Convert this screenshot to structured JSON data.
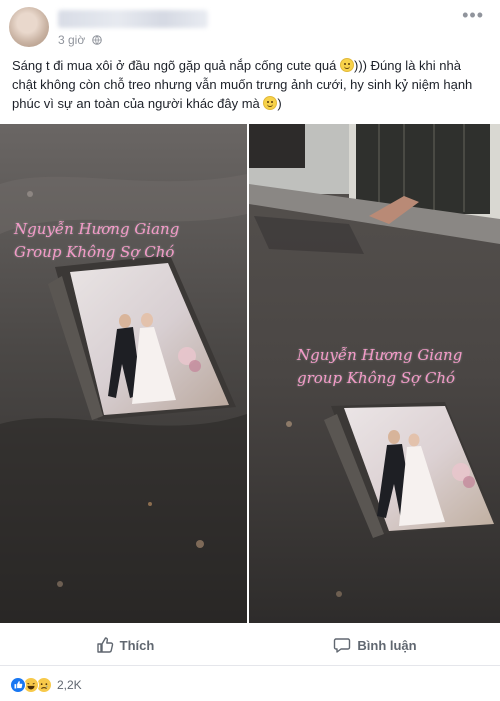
{
  "post": {
    "timestamp": "3 giờ",
    "caption": "Sáng t đi mua xôi ở đầu ngõ gặp quả nắp cống cute quá",
    "caption_mid": "))) Đúng là khi nhà chật không còn chỗ treo nhưng vẫn muốn trưng ảnh cưới, hy sinh kỷ niệm hạnh phúc vì sự an toàn của người khác đây mà",
    "more_label": "•••"
  },
  "photos": {
    "left_watermark_line1": "Nguyễn Hương Giang",
    "left_watermark_line2": "Group Không Sợ Chó",
    "right_watermark_line1": "Nguyễn Hương Giang",
    "right_watermark_line2": "group Không Sợ Chó"
  },
  "actions": {
    "like_label": "Thích",
    "comment_label": "Bình luận"
  },
  "reactions": {
    "count": "2,2K",
    "icons": [
      "like-icon",
      "haha-icon",
      "sad-icon"
    ]
  },
  "colors": {
    "text": "#1d2129",
    "meta": "#90949c",
    "action": "#606770",
    "watermark": "#f39ac8",
    "like_blue": "#1877f2"
  }
}
